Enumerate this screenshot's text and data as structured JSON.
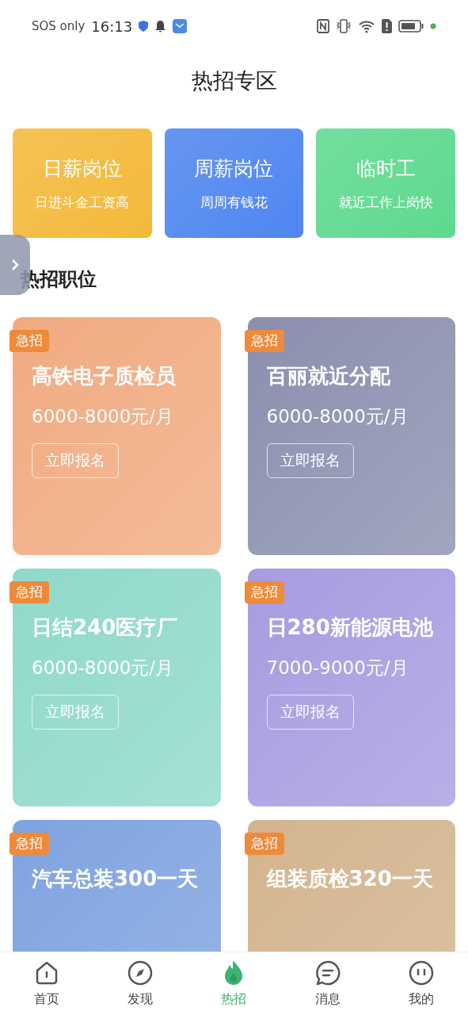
{
  "status_bar": {
    "carrier": "SOS only",
    "time": "16:13"
  },
  "title": "热招专区",
  "categories": [
    {
      "title": "日薪岗位",
      "subtitle": "日进斗金工资高",
      "color": "#f4b93a"
    },
    {
      "title": "周薪岗位",
      "subtitle": "周周有钱花",
      "color": "#4f86f0"
    },
    {
      "title": "临时工",
      "subtitle": "就近工作上岗快",
      "color": "#5ed98f"
    }
  ],
  "section_title": "热招职位",
  "jobs": [
    {
      "badge": "急招",
      "title": "高铁电子质检员",
      "salary": "6000-8000元/月",
      "button": "立即报名",
      "color": "#f1aa80"
    },
    {
      "badge": "急招",
      "title": "百丽就近分配",
      "salary": "6000-8000元/月",
      "button": "立即报名",
      "color": "#8a8fae"
    },
    {
      "badge": "急招",
      "title": "日结240医疗厂",
      "salary": "6000-8000元/月",
      "button": "立即报名",
      "color": "#8fd9cb"
    },
    {
      "badge": "急招",
      "title": "日280新能源电池",
      "salary": "7000-9000元/月",
      "button": "立即报名",
      "color": "#a89be0"
    },
    {
      "badge": "急招",
      "title": "汽车总装300一天",
      "color": "#7fa3e0"
    },
    {
      "badge": "急招",
      "title": "组装质检320一天",
      "color": "#d3b48e"
    }
  ],
  "nav": [
    {
      "label": "首页",
      "kind": "home",
      "selected": false
    },
    {
      "label": "发现",
      "kind": "discover",
      "selected": false
    },
    {
      "label": "热招",
      "kind": "hot",
      "selected": true
    },
    {
      "label": "消息",
      "kind": "message",
      "selected": false
    },
    {
      "label": "我的",
      "kind": "me",
      "selected": false
    }
  ]
}
